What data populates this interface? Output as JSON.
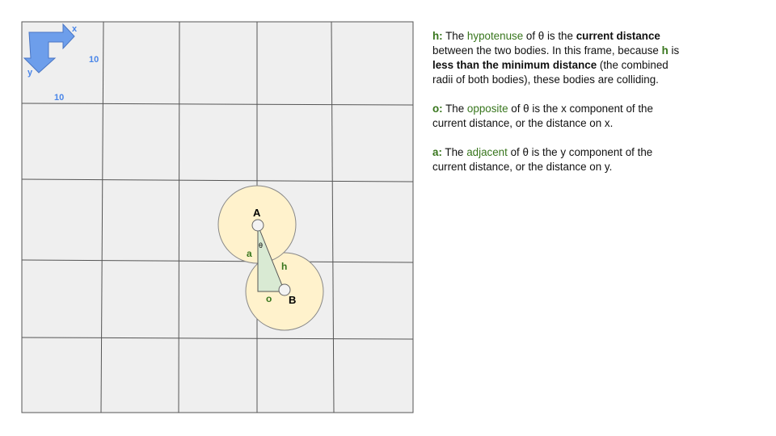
{
  "colors": {
    "background": "#ffffff",
    "grid_fill": "#efefef",
    "grid_line": "#555555",
    "body_fill": "#fff2cc",
    "body_stroke": "#888888",
    "triangle_fill": "#d9ead3",
    "triangle_stroke": "#555555",
    "axis_arrow_fill": "#6d9eeb",
    "axis_arrow_stroke": "#4a76c4",
    "axis_label": "#4a86e8",
    "term_green": "#38761d",
    "text": "#111111"
  },
  "axes": {
    "x_label": "x",
    "y_label": "y",
    "x_unit": "10",
    "y_unit": "10"
  },
  "bodies": [
    {
      "label": "A"
    },
    {
      "label": "B"
    }
  ],
  "triangle": {
    "theta": "θ",
    "hyp": "h",
    "opp": "o",
    "adj": "a"
  },
  "explanation": {
    "h": {
      "key": "h:",
      "text_1": " The ",
      "term": "hypotenuse",
      "text_2": " of θ is the ",
      "strong_1": "current distance",
      "text_3": " between the two bodies. In this frame, because ",
      "key_2": "h",
      "text_4": " is ",
      "strong_2": "less than the minimum distance",
      "text_5": " (the combined radii of both bodies), these bodies are colliding."
    },
    "o": {
      "key": "o:",
      "text_1": " The ",
      "term": "opposite",
      "text_2": " of θ is the x component of the current distance, or the distance on x."
    },
    "a": {
      "key": "a:",
      "text_1": " The ",
      "term": "adjacent",
      "text_2": " of θ is the y component of the current distance, or the distance on y."
    }
  }
}
